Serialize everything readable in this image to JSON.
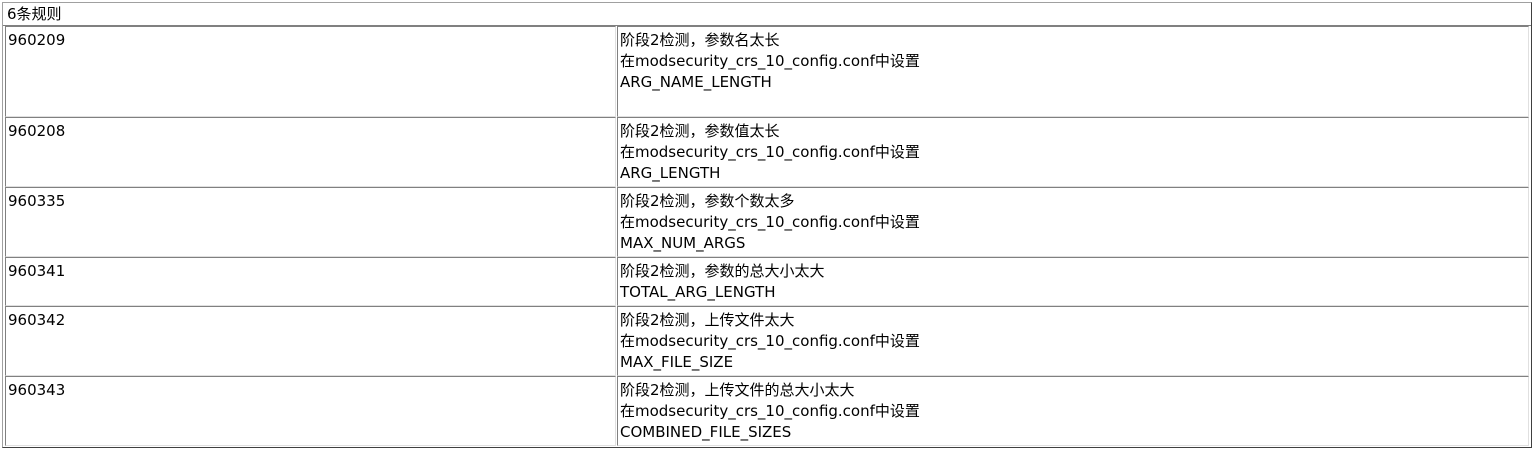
{
  "title": "6条规则",
  "rows": [
    {
      "id": "960209",
      "lines": [
        "阶段2检测，参数名太长",
        "在modsecurity_crs_10_config.conf中设置",
        "ARG_NAME_LENGTH"
      ]
    },
    {
      "id": "960208",
      "lines": [
        "阶段2检测，参数值太长",
        "在modsecurity_crs_10_config.conf中设置",
        "ARG_LENGTH"
      ]
    },
    {
      "id": "960335",
      "lines": [
        "阶段2检测，参数个数太多",
        "在modsecurity_crs_10_config.conf中设置",
        "MAX_NUM_ARGS"
      ]
    },
    {
      "id": "960341",
      "lines": [
        "阶段2检测，参数的总大小太大",
        "TOTAL_ARG_LENGTH"
      ]
    },
    {
      "id": "960342",
      "lines": [
        "阶段2检测，上传文件太大",
        "在modsecurity_crs_10_config.conf中设置",
        "MAX_FILE_SIZE"
      ]
    },
    {
      "id": "960343",
      "lines": [
        "阶段2检测，上传文件的总大小太大",
        "在modsecurity_crs_10_config.conf中设置",
        "COMBINED_FILE_SIZES"
      ]
    }
  ]
}
